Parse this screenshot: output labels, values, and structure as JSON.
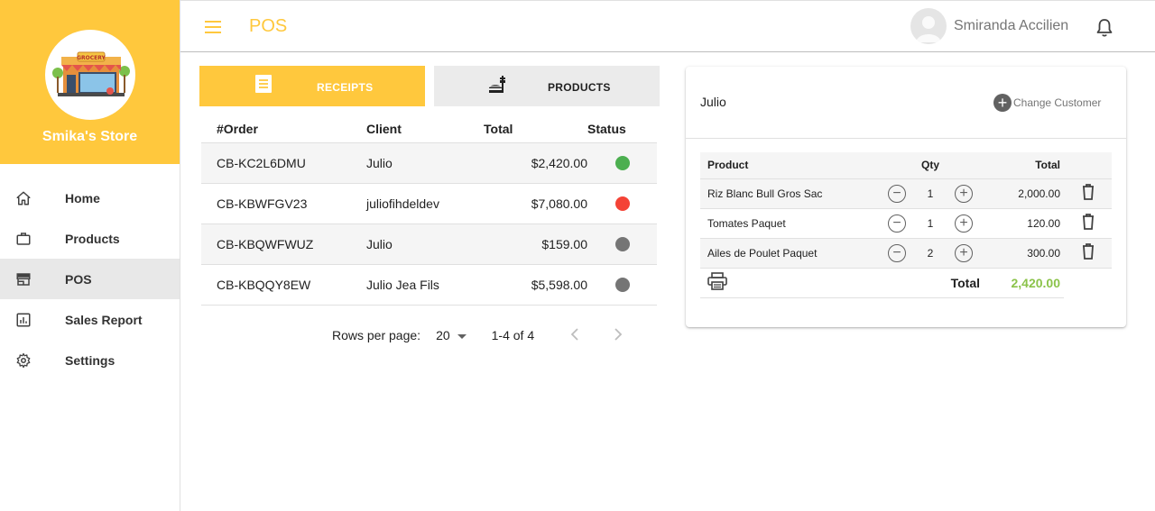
{
  "sidebar": {
    "store_name": "Smika's Store",
    "logo_text": "GROCERY",
    "items": [
      {
        "label": "Home",
        "icon": "home-icon"
      },
      {
        "label": "Products",
        "icon": "briefcase-icon"
      },
      {
        "label": "POS",
        "icon": "store-icon",
        "active": true
      },
      {
        "label": "Sales Report",
        "icon": "chart-icon"
      },
      {
        "label": "Settings",
        "icon": "gear-icon"
      }
    ]
  },
  "header": {
    "title": "POS",
    "user_name": "Smiranda Accilien"
  },
  "tabs": [
    {
      "label": "RECEIPTS",
      "icon": "receipt-icon",
      "active": true
    },
    {
      "label": "PRODUCTS",
      "icon": "food-icon"
    }
  ],
  "orders": {
    "columns": [
      "#Order",
      "Client",
      "Total",
      "Status"
    ],
    "rows": [
      {
        "order": "CB-KC2L6DMU",
        "client": "Julio",
        "total": "$2,420.00",
        "status_color": "#4caf50"
      },
      {
        "order": "CB-KBWFGV23",
        "client": "juliofihdeldev",
        "total": "$7,080.00",
        "status_color": "#f44336"
      },
      {
        "order": "CB-KBQWFWUZ",
        "client": "Julio",
        "total": "$159.00",
        "status_color": "#757575"
      },
      {
        "order": "CB-KBQQY8EW",
        "client": "Julio Jea Fils",
        "total": "$5,598.00",
        "status_color": "#757575"
      }
    ]
  },
  "pagination": {
    "rows_per_page_label": "Rows per page:",
    "rows_per_page": "20",
    "range": "1-4 of 4"
  },
  "cart": {
    "customer": "Julio",
    "change_customer_label": "Change Customer",
    "columns": {
      "product": "Product",
      "qty": "Qty",
      "total": "Total"
    },
    "items": [
      {
        "product": "Riz Blanc Bull Gros Sac",
        "qty": "1",
        "total": "2,000.00"
      },
      {
        "product": "Tomates Paquet",
        "qty": "1",
        "total": "120.00"
      },
      {
        "product": "Ailes de Poulet Paquet",
        "qty": "2",
        "total": "300.00"
      }
    ],
    "total_label": "Total",
    "total_value": "2,420.00"
  },
  "colors": {
    "accent": "#ffc83d",
    "total_green": "#8bc34a"
  }
}
